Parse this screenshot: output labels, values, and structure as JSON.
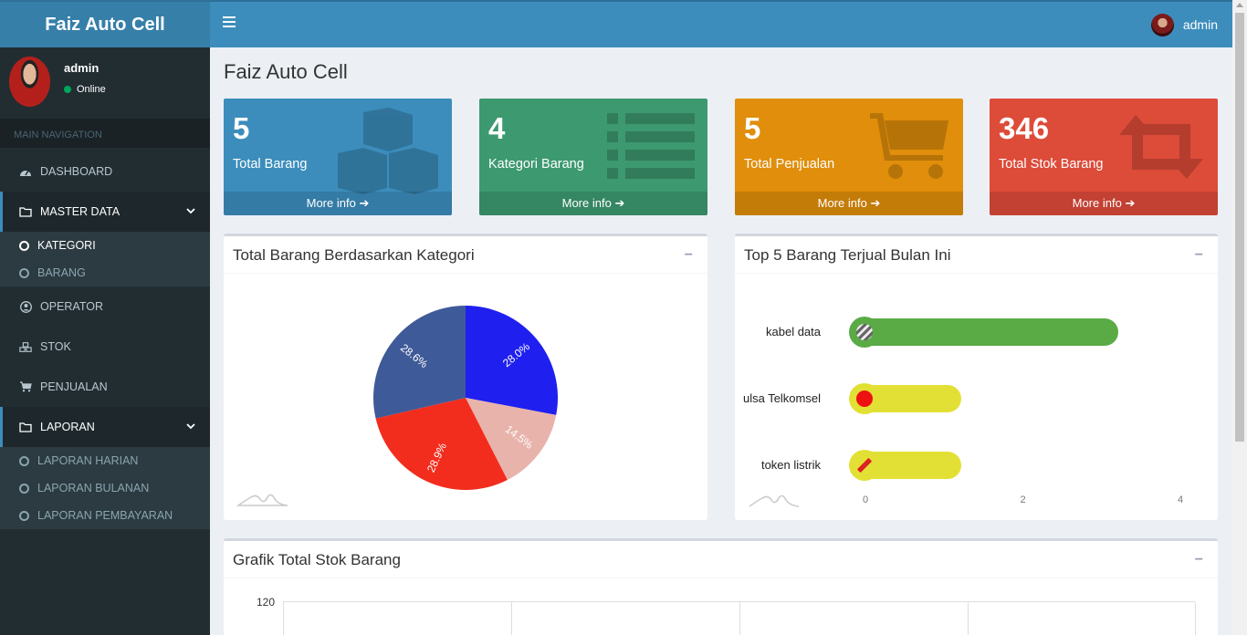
{
  "app": {
    "title": "Faiz Auto Cell"
  },
  "navbar": {
    "user_name": "admin"
  },
  "sidebar": {
    "user": {
      "name": "admin",
      "status": "Online"
    },
    "header": "MAIN NAVIGATION",
    "items": [
      {
        "label": "DASHBOARD",
        "icon": "dashboard-icon"
      },
      {
        "label": "MASTER DATA",
        "icon": "folder-icon"
      },
      {
        "label": "OPERATOR",
        "icon": "user-circle-icon"
      },
      {
        "label": "STOK",
        "icon": "cubes-icon"
      },
      {
        "label": "PENJUALAN",
        "icon": "cart-icon"
      },
      {
        "label": "LAPORAN",
        "icon": "folder-icon"
      }
    ],
    "master_sub": [
      "KATEGORI",
      "BARANG"
    ],
    "laporan_sub": [
      "LAPORAN HARIAN",
      "LAPORAN BULANAN",
      "LAPORAN PEMBAYARAN"
    ]
  },
  "page": {
    "title": "Faiz Auto Cell"
  },
  "stats": [
    {
      "value": "5",
      "label": "Total Barang",
      "more": "More info",
      "color": "#3c8dbc",
      "icon": "cubes-icon"
    },
    {
      "value": "4",
      "label": "Kategori Barang",
      "more": "More info",
      "color": "#3d9970",
      "icon": "list-icon"
    },
    {
      "value": "5",
      "label": "Total Penjualan",
      "more": "More info",
      "color": "#e08e0b",
      "icon": "cart-icon"
    },
    {
      "value": "346",
      "label": "Total Stok Barang",
      "more": "More info",
      "color": "#dd4b39",
      "icon": "retweet-icon"
    }
  ],
  "boxes": {
    "pie_title": "Total Barang Berdasarkan Kategori",
    "bar_title": "Top 5 Barang Terjual Bulan Ini",
    "stock_title": "Grafik Total Stok Barang",
    "collapse": "−"
  },
  "chart_data": [
    {
      "type": "pie",
      "slices": [
        {
          "label": "28.0%",
          "value": 28.0,
          "color": "#1f1ff0"
        },
        {
          "label": "14.5%",
          "value": 14.5,
          "color": "#e8b3ab"
        },
        {
          "label": "28.9%",
          "value": 28.9,
          "color": "#f22d1e"
        },
        {
          "label": "28.6%",
          "value": 28.6,
          "color": "#3f5a98"
        }
      ]
    },
    {
      "type": "bar",
      "orientation": "horizontal",
      "categories": [
        "kabel data",
        "ulsa Telkomsel",
        "token listrik"
      ],
      "values": [
        3.2,
        1.2,
        1.2
      ],
      "colors": [
        "#5aab45",
        "#e3e035",
        "#e3e035"
      ],
      "xlim": [
        0,
        4
      ],
      "x_ticks": [
        "0",
        "2",
        "4"
      ]
    },
    {
      "type": "bar",
      "ylim": [
        0,
        120
      ],
      "y_ticks": [
        "120"
      ]
    }
  ]
}
